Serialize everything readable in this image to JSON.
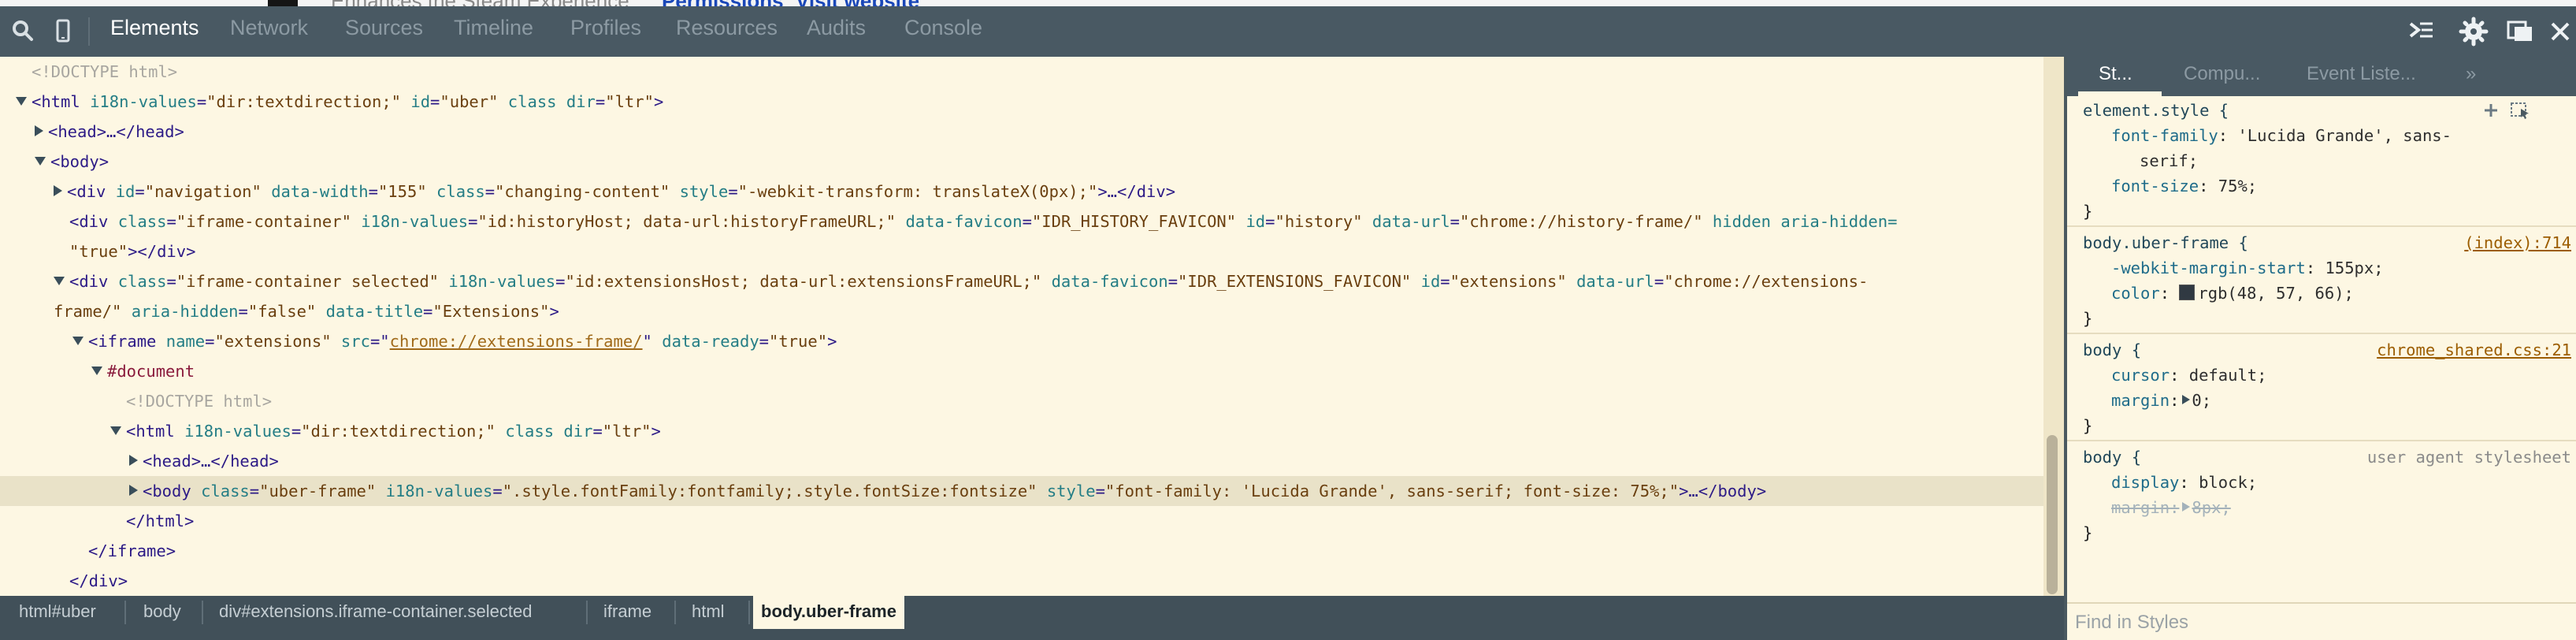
{
  "background_page": {
    "text_left": "Enhances the Steam Experience",
    "link_permissions": "Permissions",
    "link_visit": "Visit website"
  },
  "toolbar": {
    "tabs": [
      "Elements",
      "Network",
      "Sources",
      "Timeline",
      "Profiles",
      "Resources",
      "Audits",
      "Console"
    ],
    "active_tab": "Elements"
  },
  "dom": {
    "l0": "<!DOCTYPE html>",
    "l1_tag_open": "<html ",
    "l1_a1": "i18n-values",
    "l1_v1": "\"dir:textdirection;\"",
    "l1_a2": "id",
    "l1_v2": "\"uber\"",
    "l1_a3": "class",
    "l1_a4": "dir",
    "l1_v4": "\"ltr\"",
    "l1_close": ">",
    "l2": "<head>…</head>",
    "l3": "<body>",
    "l4_open": "<div ",
    "l4_a1": "id",
    "l4_v1": "\"navigation\"",
    "l4_a2": "data-width",
    "l4_v2": "\"155\"",
    "l4_a3": "class",
    "l4_v3": "\"changing-content\"",
    "l4_a4": "style",
    "l4_v4": "\"-webkit-transform: translateX(0px);\"",
    "l4_close": ">…</div>",
    "l5_open": "<div ",
    "l5_a1": "class",
    "l5_v1": "\"iframe-container\"",
    "l5_a2": "i18n-values",
    "l5_v2": "\"id:historyHost; data-url:historyFrameURL;\"",
    "l5_a3": "data-favicon",
    "l5_v3": "\"IDR_HISTORY_FAVICON\"",
    "l5_a4": "id",
    "l5_v4": "\"history\"",
    "l5_a5": "data-url",
    "l5_v5": "\"chrome://history-frame/\"",
    "l5_a6": "hidden",
    "l5_a7": "aria-hidden=",
    "l6_v": "\"true\"",
    "l6_close": "></div>",
    "l7_open": "<div ",
    "l7_a1": "class",
    "l7_v1": "\"iframe-container selected\"",
    "l7_a2": "i18n-values",
    "l7_v2": "\"id:extensionsHost; data-url:extensionsFrameURL;\"",
    "l7_a3": "data-favicon",
    "l7_v3": "\"IDR_EXTENSIONS_FAVICON\"",
    "l7_a4": "id",
    "l7_v4": "\"extensions\"",
    "l7_a5": "data-url",
    "l7_v5": "\"chrome://extensions-",
    "l8_v": "frame/\"",
    "l8_a1": "aria-hidden",
    "l8_v1": "\"false\"",
    "l8_a2": "data-title",
    "l8_v2": "\"Extensions\"",
    "l8_close": ">",
    "l9_open": "<iframe ",
    "l9_a1": "name",
    "l9_v1": "\"extensions\"",
    "l9_a2": "src",
    "l9_link": "chrome://extensions-frame/",
    "l9_a3": "data-ready",
    "l9_v3": "\"true\"",
    "l9_close": ">",
    "l10": "#document",
    "l11": "<!DOCTYPE html>",
    "l12_open": "<html ",
    "l12_a1": "i18n-values",
    "l12_v1": "\"dir:textdirection;\"",
    "l12_a2": "class",
    "l12_a3": "dir",
    "l12_v3": "\"ltr\"",
    "l12_close": ">",
    "l13": "<head>…</head>",
    "l14_open": "<body ",
    "l14_a1": "class",
    "l14_v1": "\"uber-frame\"",
    "l14_a2": "i18n-values",
    "l14_v2": "\".style.fontFamily:fontfamily;.style.fontSize:fontsize\"",
    "l14_a3": "style",
    "l14_v3": "\"font-family: 'Lucida Grande', sans-serif; font-size: 75%;\"",
    "l14_close": ">…</body>",
    "l15": "</html>",
    "l16": "</iframe>",
    "l17": "</div>"
  },
  "breadcrumbs": [
    "html#uber",
    "body",
    "div#extensions.iframe-container.selected",
    "iframe",
    "html",
    "body.uber-frame"
  ],
  "styles": {
    "tabs": [
      "St...",
      "Compu...",
      "Event Liste...",
      "»"
    ],
    "active_tab": "St...",
    "element_style": {
      "selector": "element.style {",
      "p1": "font-family",
      "v1a": "'Lucida Grande', sans-",
      "v1b": "serif;",
      "p2": "font-size",
      "v2": "75%;",
      "close": "}"
    },
    "rule_uber": {
      "selector": "body.uber-frame {",
      "source": "(index):714",
      "p1": "-webkit-margin-start",
      "v1": "155px;",
      "p2": "color",
      "v2": "rgb(48, 57, 66);",
      "swatch_color": "#303942",
      "close": "}"
    },
    "rule_shared": {
      "selector": "body {",
      "source": "chrome_shared.css:21",
      "p1": "cursor",
      "v1": "default;",
      "p2": "margin",
      "v2": "0;",
      "close": "}"
    },
    "rule_ua": {
      "selector": "body {",
      "source": "user agent stylesheet",
      "p1": "display",
      "v1": "block;",
      "p2": "margin",
      "v2": "8px;",
      "close": "}"
    },
    "find_placeholder": "Find in Styles"
  },
  "colors": {
    "toolbar": "#495963",
    "pane_bg": "#fdf7e3",
    "tag": "#2c1a86",
    "attr_name": "#247d85",
    "attr_value": "#6a3f0f",
    "link": "#a06a1a"
  }
}
